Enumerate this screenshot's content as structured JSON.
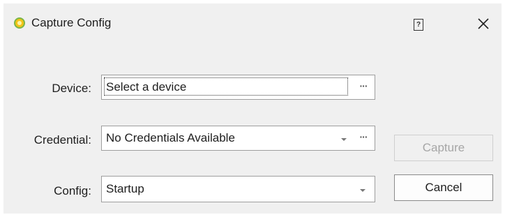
{
  "window": {
    "title": "Capture Config",
    "help_glyph": "?",
    "icons": {
      "app": "gear-flower-icon",
      "help": "help-icon",
      "close": "close-icon"
    }
  },
  "form": {
    "device": {
      "label": "Device:",
      "value": "Select a device",
      "browse": "···"
    },
    "credential": {
      "label": "Credential:",
      "value": "No Credentials Available",
      "browse": "···"
    },
    "config": {
      "label": "Config:",
      "value": "Startup"
    }
  },
  "buttons": {
    "capture": {
      "label": "Capture",
      "enabled": false
    },
    "cancel": {
      "label": "Cancel",
      "enabled": true
    }
  },
  "colors": {
    "accent_icon": "#e6b71c",
    "dialog_bg": "#f0f0f0",
    "disabled_text": "#a6a6a6"
  }
}
